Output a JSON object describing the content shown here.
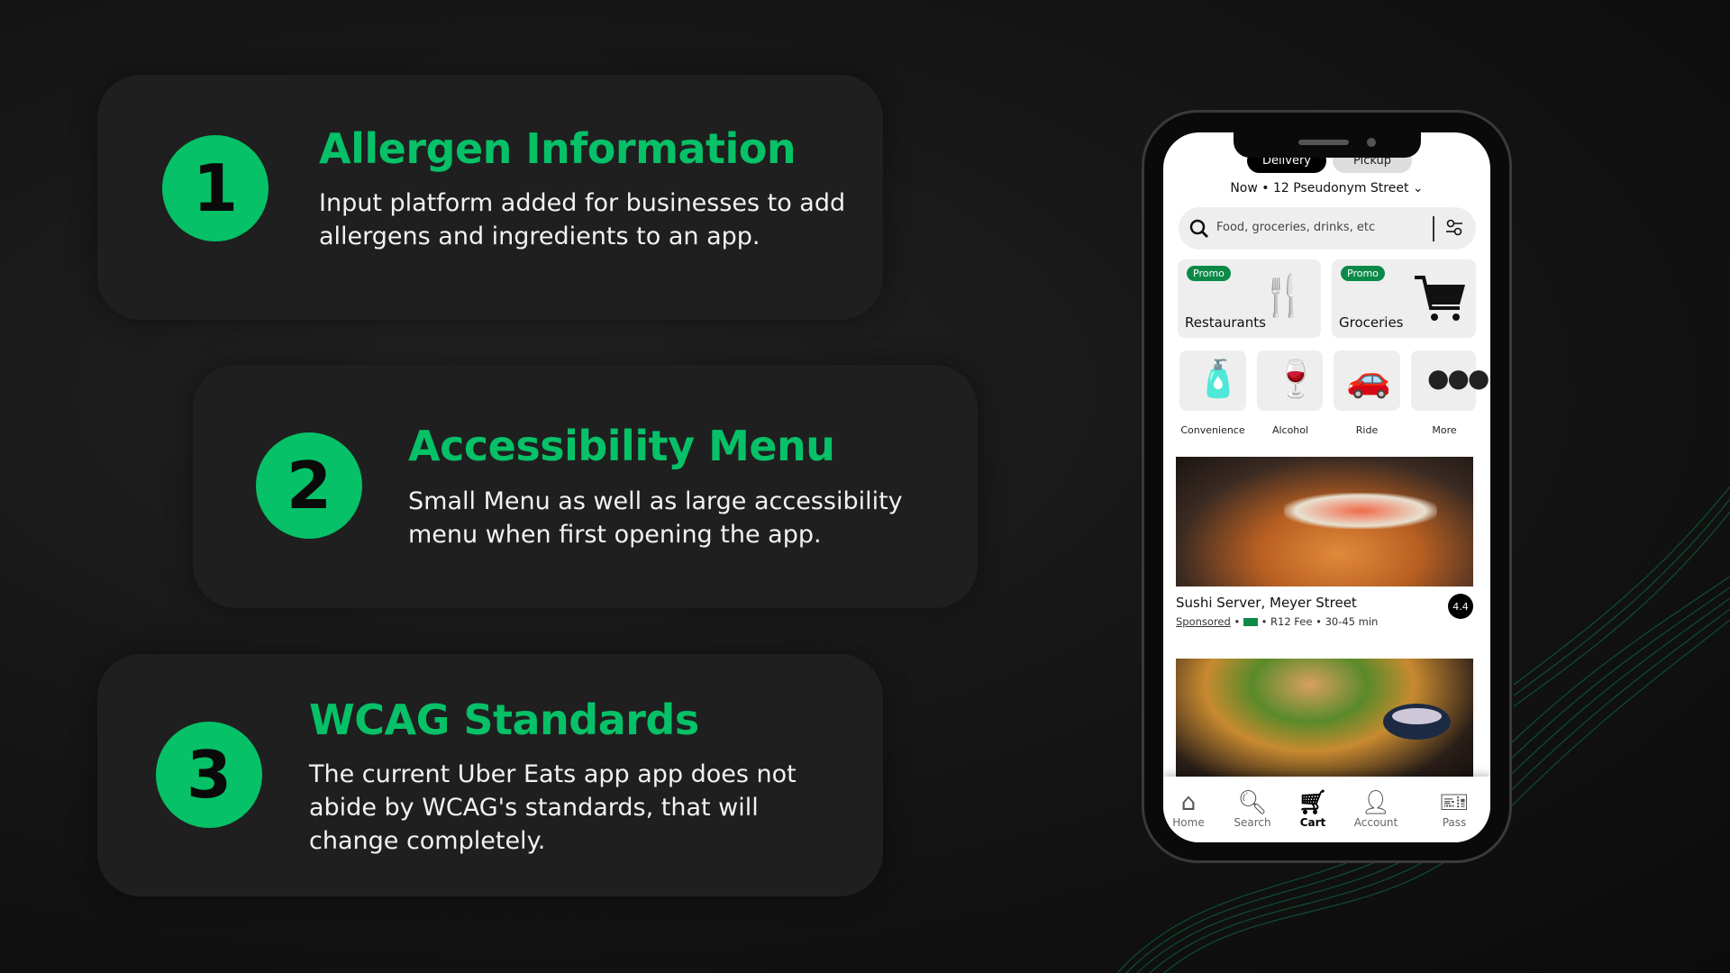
{
  "colors": {
    "accent": "#06c167",
    "background": "#141414",
    "card": "#1f1f1f"
  },
  "cards": [
    {
      "number": "1",
      "title": "Allergen Information",
      "body": "Input platform added for businesses to add allergens and ingredients to an app."
    },
    {
      "number": "2",
      "title": "Accessibility Menu",
      "body": "Small Menu as well as large accessibility menu when first opening the app."
    },
    {
      "number": "3",
      "title": "WCAG Standards",
      "body": "The current Uber Eats app app does not abide by WCAG's standards, that will change completely."
    }
  ],
  "phone": {
    "tabs": [
      {
        "label": "Delivery",
        "active": true
      },
      {
        "label": "Pickup",
        "active": false
      }
    ],
    "address": "Now • 12 Pseudonym Street",
    "search": {
      "placeholder": "Food, groceries, drinks, etc",
      "icon": "search-icon",
      "filter_icon": "filter-icon"
    },
    "promo_tiles": [
      {
        "badge": "Promo",
        "label": "Restaurants",
        "icon": "cutlery-icon"
      },
      {
        "badge": "Promo",
        "label": "Groceries",
        "icon": "cart-icon"
      }
    ],
    "categories": [
      {
        "label": "Convenience",
        "icon": "toiletries-icon"
      },
      {
        "label": "Alcohol",
        "icon": "wine-glass-icon"
      },
      {
        "label": "Ride",
        "icon": "car-icon"
      },
      {
        "label": "More",
        "icon": "more-icon"
      }
    ],
    "restaurant": {
      "name": "Sushi Server, Meyer Street",
      "sponsored": "Sponsored",
      "fee": "R12 Fee",
      "time": "30-45 min",
      "rating": "4.4"
    },
    "nav": [
      {
        "label": "Home",
        "icon": "home-icon"
      },
      {
        "label": "Search",
        "icon": "search-icon"
      },
      {
        "label": "Cart",
        "icon": "cart-icon",
        "active": true
      },
      {
        "label": "Account",
        "icon": "account-icon"
      },
      {
        "label": "Pass",
        "icon": "ticket-icon"
      }
    ]
  }
}
